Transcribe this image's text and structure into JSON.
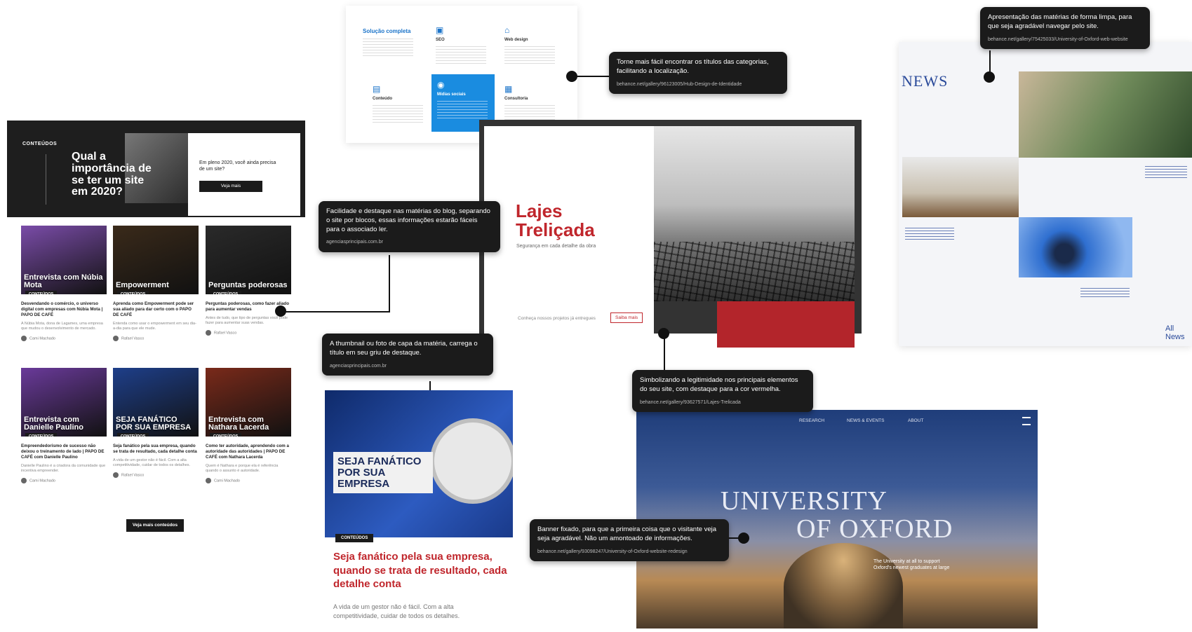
{
  "blog": {
    "hero": {
      "tag": "CONTEÚDOS",
      "title": "Qual a importância de se ter um site em 2020?",
      "question": "Em pleno 2020, você ainda precisa de um site?",
      "button": "Veja mais"
    },
    "posts": [
      {
        "thumb": "Entrevista com Núbia Mota",
        "badge": "CONTEÚDOS",
        "title": "Desvendando o comércio, o universo digital com empresas com Núbia Mota | PAPO DE CAFÉ",
        "excerpt": "A Núbia Mota, dona de Lagames, uma empresa que mudou o desenvolvimento de mercado.",
        "author": "Cami Machado",
        "color": "#7a4ca8"
      },
      {
        "thumb": "Empowerment",
        "badge": "CONTEÚDOS",
        "title": "Aprenda como Empowerment pode ser sua aliado para dar certo com o PAPO DE CAFÉ",
        "excerpt": "Entenda como usar o empowerment em seu dia-a-dia para que ele mude.",
        "author": "Rafael Vasco",
        "color": "#3a2a1a"
      },
      {
        "thumb": "Perguntas poderosas",
        "badge": "CONTEÚDOS",
        "title": "Perguntas poderosas, como fazer aliado para aumentar vendas",
        "excerpt": "Antes de tudo, que tipo de perguntas você pode fazer para aumentar suas vendas.",
        "author": "Rafael Vasco",
        "color": "#2a2a2a"
      },
      {
        "thumb": "Entrevista com Danielle Paulino",
        "badge": "CONTEÚDOS",
        "title": "Empreendedorismo de sucesso não deixou o treinamento de lado | PAPO DE CAFÉ com Danielle Paulino",
        "excerpt": "Danielle Paulino é a criadora da comunidade que incentiva empreender.",
        "author": "Cami Machado",
        "color": "#6a3a9a"
      },
      {
        "thumb": "SEJA FANÁTICO POR SUA EMPRESA",
        "badge": "CONTEÚDOS",
        "title": "Seja fanático pela sua empresa, quando se trata de resultado, cada detalhe conta",
        "excerpt": "A vida de um gestor não é fácil. Com a alta competitividade, cuidar de todos os detalhes.",
        "author": "Rafael Vasco",
        "color": "#1e3f8a"
      },
      {
        "thumb": "Entrevista com Nathara Lacerda",
        "badge": "CONTEÚDOS",
        "title": "Como ter autoridade, aprendendo com a autoridade das autoridades | PAPO DE CAFÉ com Nathara Lacerda",
        "excerpt": "Quem é Nathara e porque ela é referência quando o assunto é autoridade.",
        "author": "Cami Machado",
        "color": "#7a2a1a"
      }
    ],
    "more_button": "Veja mais conteúdos"
  },
  "categories": {
    "items": [
      {
        "icon": "✓",
        "title": "Solução completa"
      },
      {
        "icon": "▣",
        "title": "SEO"
      },
      {
        "icon": "⌂",
        "title": "Web design"
      },
      {
        "icon": "▤",
        "title": "Conteúdo"
      },
      {
        "icon": "◉",
        "title": "Mídias sociais"
      },
      {
        "icon": "▦",
        "title": "Consultoria"
      }
    ]
  },
  "lajes": {
    "title_line1": "Lajes",
    "title_line2": "Treliçada",
    "subtitle": "Segurança em cada detalhe da obra",
    "footer_text": "Conheça nossos projetos já entregues",
    "footer_button": "Saiba mais"
  },
  "news": {
    "logo": "NEWS",
    "all_news": "All News"
  },
  "oxford": {
    "nav": [
      "RESEARCH",
      "NEWS & EVENTS",
      "ABOUT"
    ],
    "title_line1": "UNIVERSITY",
    "title_line2": "OF OXFORD",
    "side_text": "The University at all to support Oxford's newest graduates at large"
  },
  "callouts": {
    "categories": {
      "text": "Torne mais fácil encontrar os títulos das categorias, facilitando a localização.",
      "source": "behance.net/gallery/96123005/Hub-Design-de-Identidade"
    },
    "blog": {
      "text": "Facilidade e destaque nas matérias do blog, separando o site por blocos, essas informações estarão fáceis para o associado ler.",
      "source": "agenciasprincipais.com.br"
    },
    "thumb": {
      "text": "A thumbnail ou foto de capa da matéria, carrega o título em seu griu de destaque.",
      "source": "agenciasprincipais.com.br"
    },
    "lajes": {
      "text": "Simbolizando a legitimidade nos principais elementos do seu site, com destaque para a cor vermelha.",
      "source": "behance.net/gallery/93627571/Lajes-Trelicada"
    },
    "oxford": {
      "text": "Banner fixado, para que a primeira coisa que o visitante veja seja agradável. Não um amontoado de informações.",
      "source": "behance.net/gallery/93098247/University-of-Oxford-website-redesign"
    },
    "news": {
      "text": "Apresentação das matérias de forma limpa, para que seja agradável navegar pelo site.",
      "source": "behance.net/gallery/75425033/University-of-Oxford-web-website"
    }
  }
}
